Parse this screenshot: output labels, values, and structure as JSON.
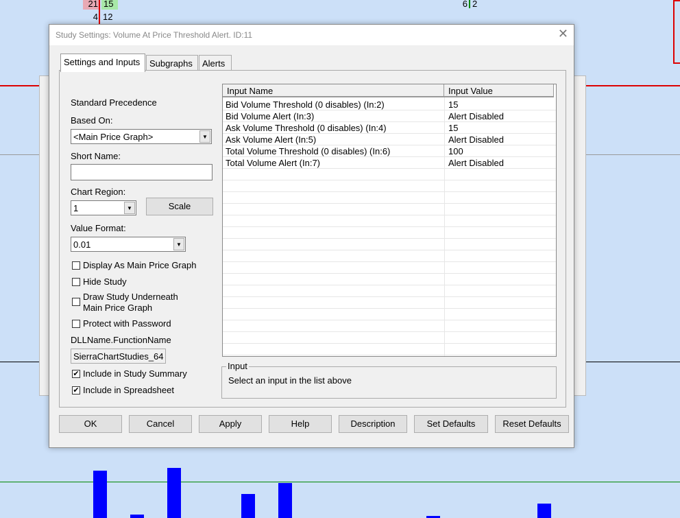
{
  "chart": {
    "top_left_bid": "21",
    "top_left_ask": "15",
    "second_bid": "4",
    "second_ask": "12",
    "top_mid_bid": "6",
    "top_mid_ask": "2",
    "colors": {
      "background": "#cce0f8",
      "bid_highlight": "#e8a9b4",
      "ask_highlight": "#a8e8a8",
      "volume_bar": "#0000ff"
    }
  },
  "dialog": {
    "title": "Study Settings: Volume At Price Threshold Alert. ID:11",
    "tabs": [
      {
        "label": "Settings and Inputs"
      },
      {
        "label": "Subgraphs"
      },
      {
        "label": "Alerts"
      }
    ],
    "left": {
      "standard_precedence": "Standard Precedence",
      "based_on_label": "Based On:",
      "based_on_value": "<Main Price Graph>",
      "short_name_label": "Short Name:",
      "short_name_value": "",
      "chart_region_label": "Chart Region:",
      "chart_region_value": "1",
      "scale_button": "Scale",
      "value_format_label": "Value Format:",
      "value_format_value": "0.01",
      "checkboxes": [
        {
          "label": "Display As Main Price Graph",
          "checked": false
        },
        {
          "label": "Hide Study",
          "checked": false
        },
        {
          "label": "Draw Study Underneath",
          "label2": "Main Price Graph",
          "checked": false
        },
        {
          "label": "Protect with Password",
          "checked": false
        }
      ],
      "dll_label": "DLLName.FunctionName",
      "dll_value": "SierraChartStudies_64",
      "include_summary": {
        "label": "Include in Study Summary",
        "checked": true
      },
      "include_spreadsheet": {
        "label": "Include in Spreadsheet",
        "checked": true
      }
    },
    "grid": {
      "headers": [
        "Input Name",
        "Input Value"
      ],
      "rows": [
        {
          "name": "Bid Volume Threshold (0 disables)  (In:2)",
          "value": "15"
        },
        {
          "name": "Bid Volume Alert  (In:3)",
          "value": "Alert Disabled"
        },
        {
          "name": "Ask Volume Threshold (0 disables)  (In:4)",
          "value": "15"
        },
        {
          "name": "Ask Volume Alert  (In:5)",
          "value": "Alert Disabled"
        },
        {
          "name": "Total Volume Threshold (0 disables)  (In:6)",
          "value": "100"
        },
        {
          "name": "Total Volume Alert  (In:7)",
          "value": "Alert Disabled"
        }
      ]
    },
    "input_group": {
      "label": "Input",
      "text": "Select an input in the list above"
    },
    "buttons": {
      "ok": "OK",
      "cancel": "Cancel",
      "apply": "Apply",
      "help": "Help",
      "description": "Description",
      "set_defaults": "Set Defaults",
      "reset_defaults": "Reset Defaults"
    }
  }
}
